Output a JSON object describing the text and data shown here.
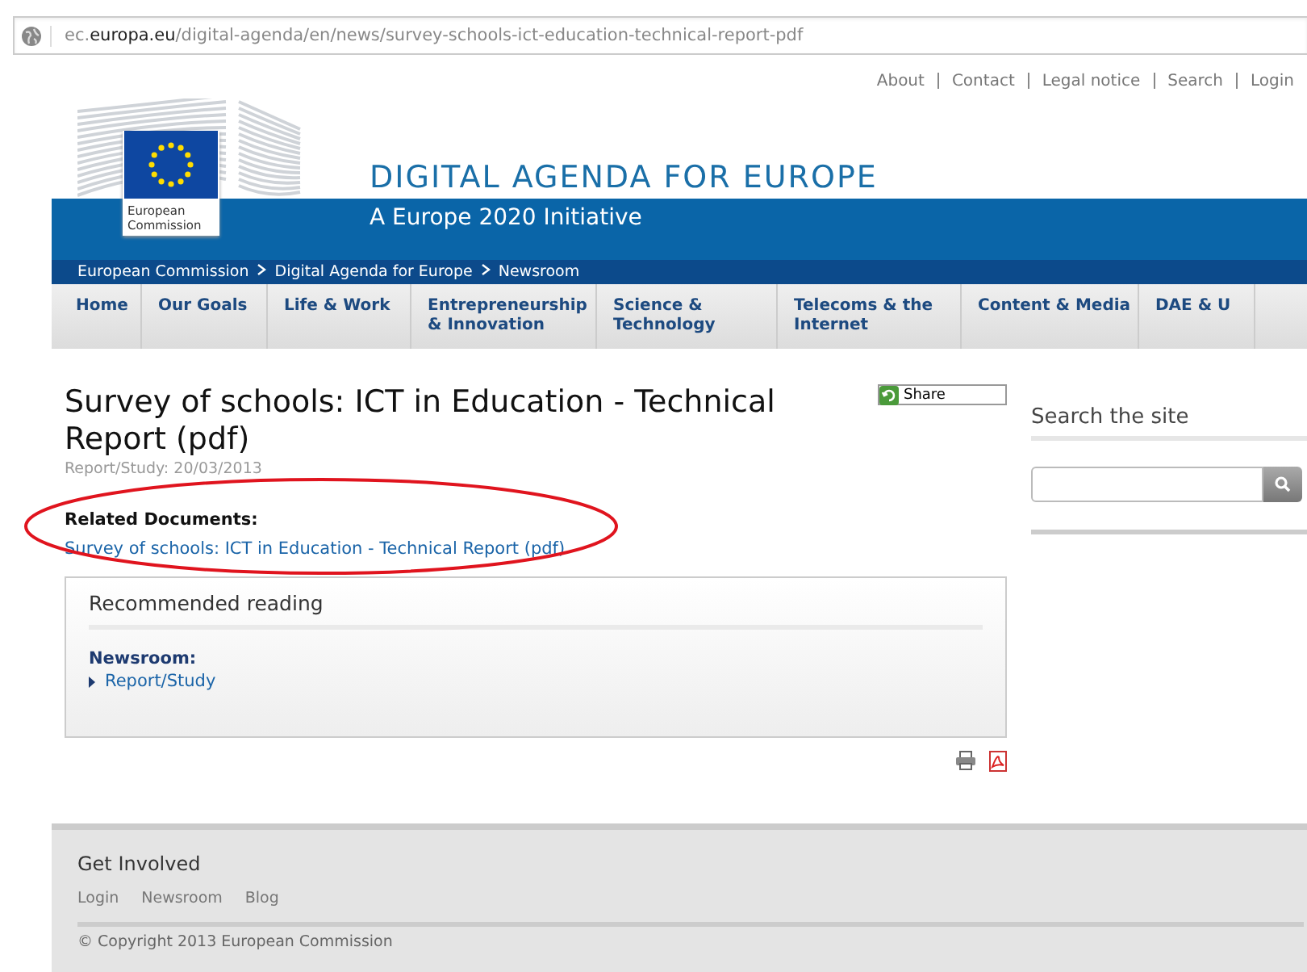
{
  "address_bar": {
    "url": "ec.**europa.eu**/digital-agenda/en/news/survey-schools-ict-education-technical-report-pdf"
  },
  "top_links": [
    "About",
    "Contact",
    "Legal notice",
    "Search",
    "Login"
  ],
  "header": {
    "logo_text": "European Commission",
    "title": "DIGITAL AGENDA FOR EUROPE",
    "subtitle": "A Europe 2020 Initiative"
  },
  "breadcrumb": [
    "European Commission",
    "Digital Agenda for Europe",
    "Newsroom"
  ],
  "nav": [
    "Home",
    "Our Goals",
    "Life & Work",
    "Entrepreneurship & Innovation",
    "Science & Technology",
    "Telecoms & the Internet",
    "Content & Media",
    "DAE & U"
  ],
  "article": {
    "title": "Survey of schools: ICT in Education - Technical Report (pdf)",
    "meta": "Report/Study: 20/03/2013",
    "share": "Share",
    "related_heading": "Related Documents:",
    "related_link": "Survey of schools: ICT in Education - Technical Report (pdf)"
  },
  "recommended": {
    "title": "Recommended reading",
    "section": "Newsroom:",
    "items": [
      "Report/Study"
    ]
  },
  "sidebar": {
    "search_title": "Search the site"
  },
  "footer": {
    "title": "Get Involved",
    "links": [
      "Login",
      "Newsroom",
      "Blog"
    ],
    "copyright": "© Copyright 2013 European Commission"
  }
}
